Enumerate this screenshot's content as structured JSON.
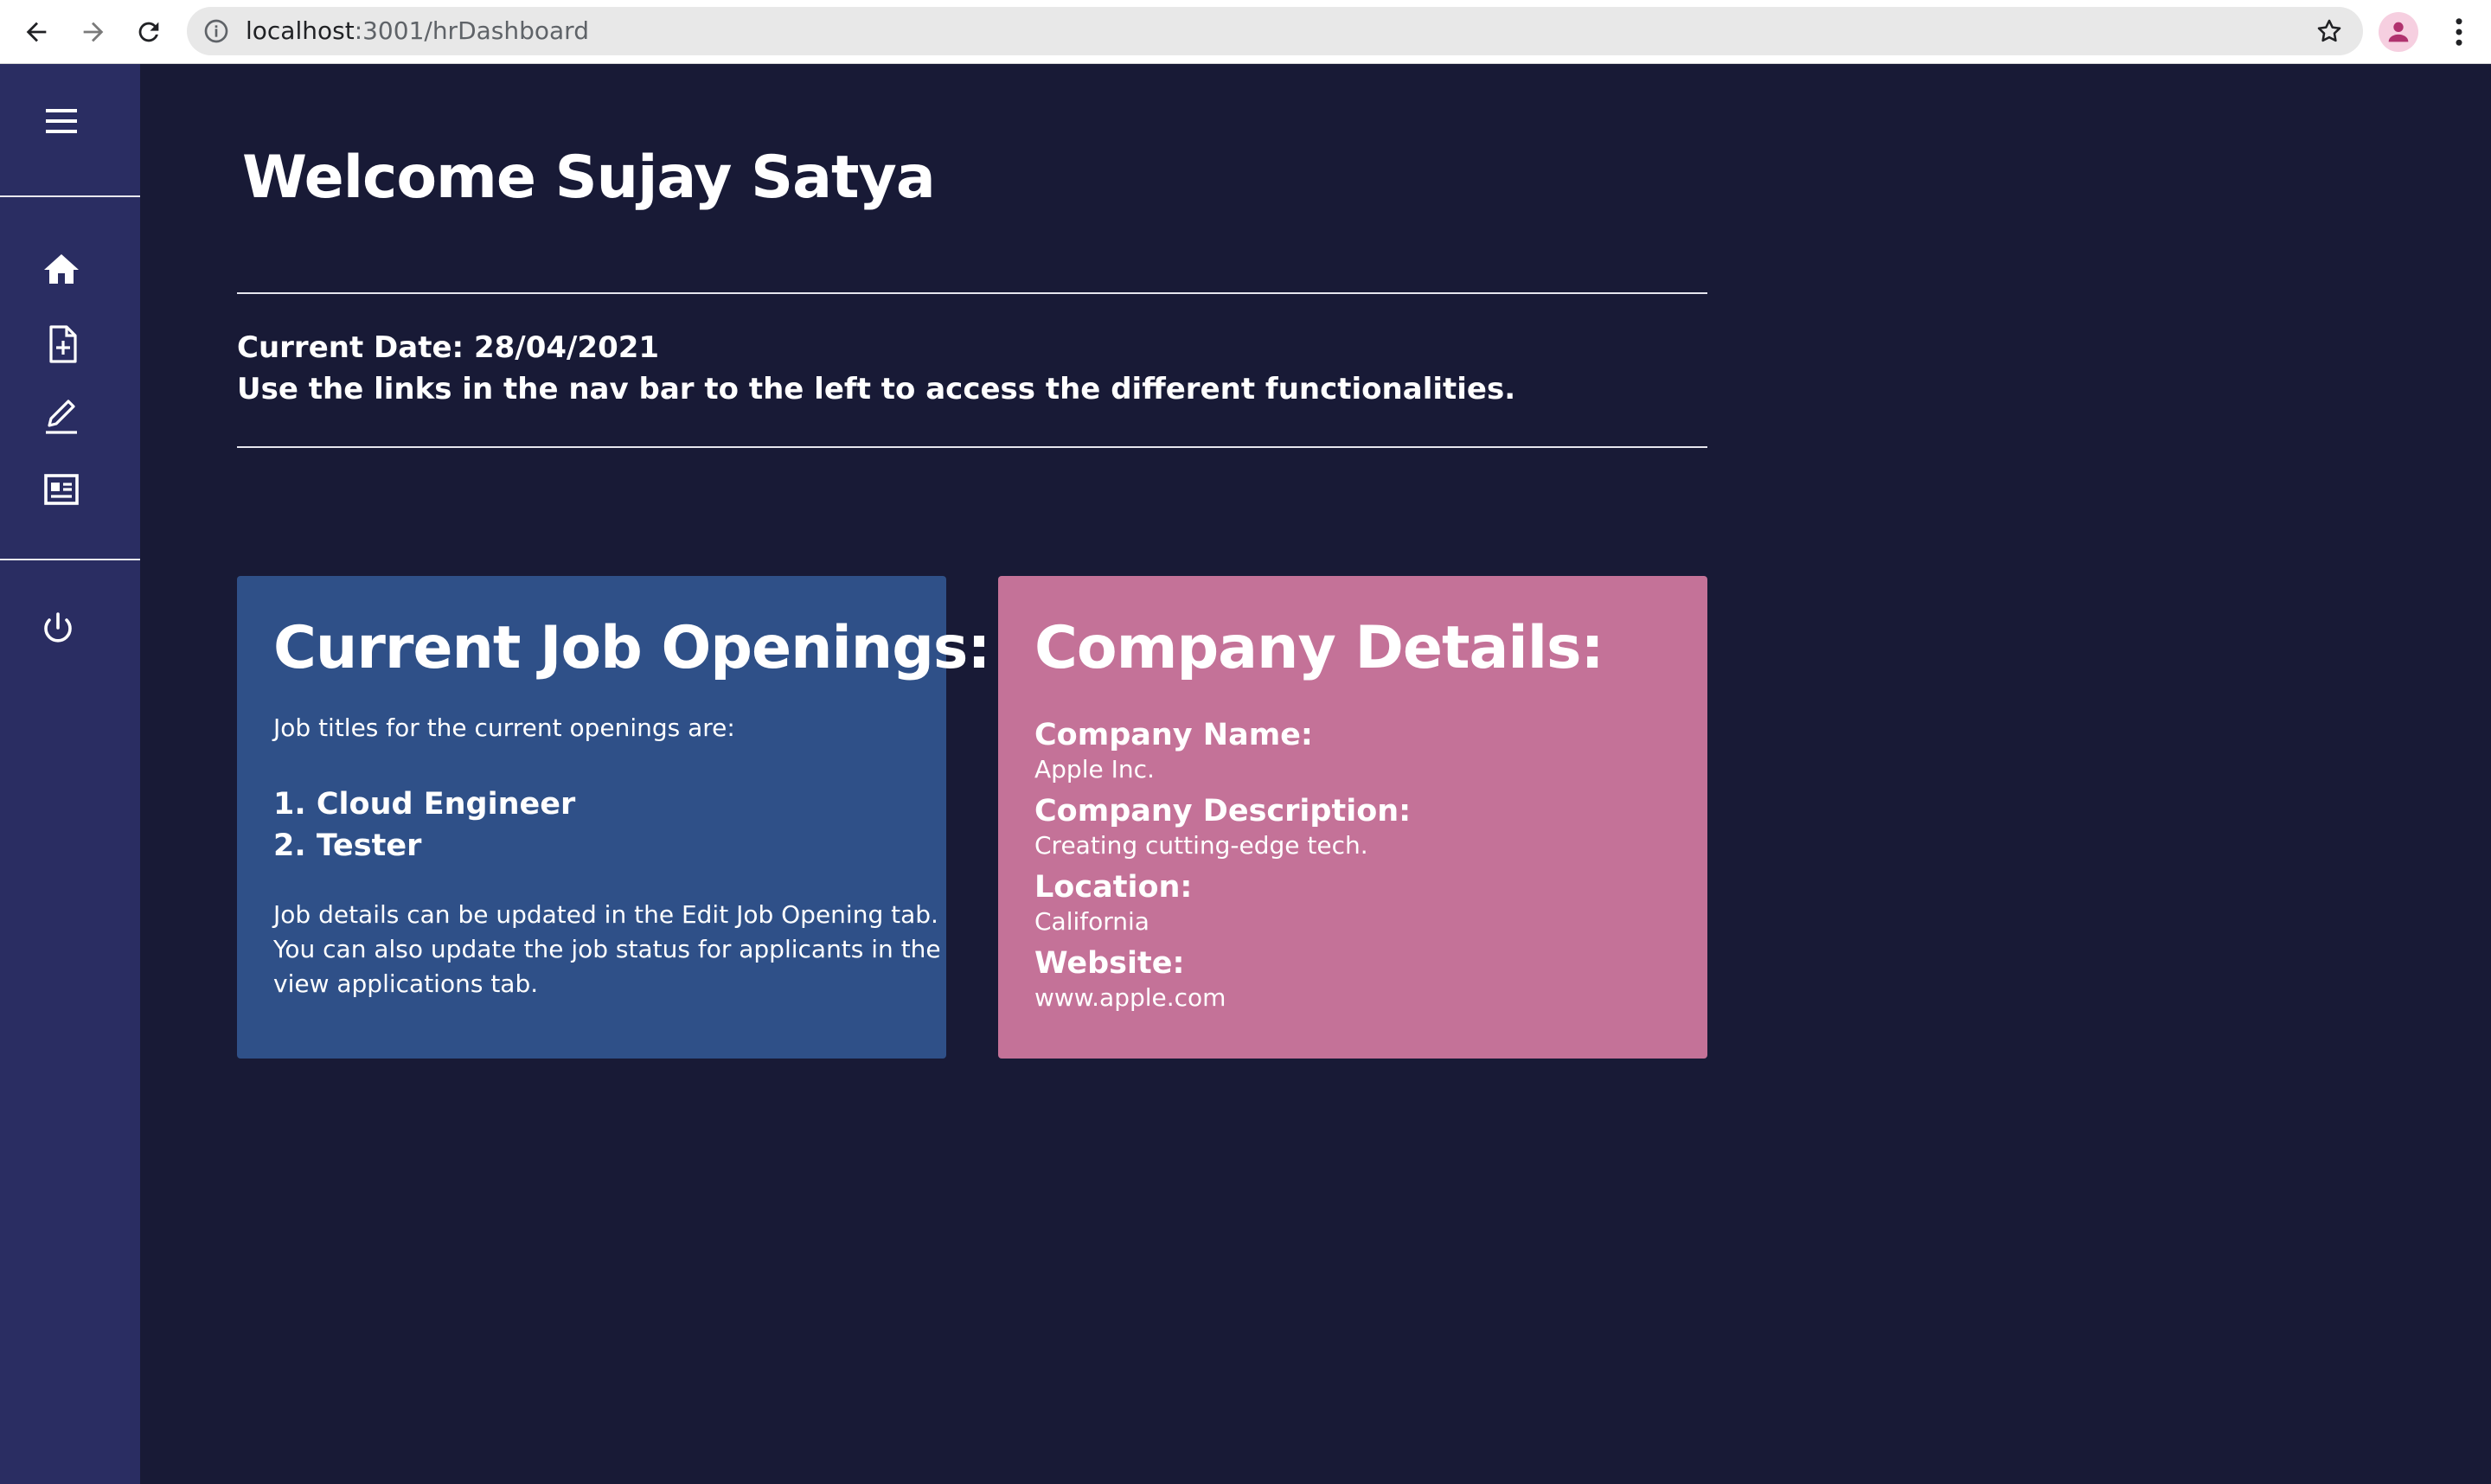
{
  "browser": {
    "url_host": "localhost",
    "url_path": ":3001/hrDashboard"
  },
  "sidebar": {
    "items": [
      {
        "icon": "menu-icon"
      },
      {
        "icon": "home-icon"
      },
      {
        "icon": "add-file-icon"
      },
      {
        "icon": "edit-icon"
      },
      {
        "icon": "applications-icon"
      },
      {
        "icon": "power-icon"
      }
    ]
  },
  "main": {
    "welcome": "Welcome Sujay Satya",
    "current_date": "Current Date: 28/04/2021",
    "nav_hint": "Use the links in the nav bar to the left to access the different functionalities."
  },
  "jobs_card": {
    "title": "Current Job Openings:",
    "intro": "Job titles for the current openings are:",
    "openings": [
      "1. Cloud Engineer",
      "2. Tester"
    ],
    "note_lines": [
      "Job details can be updated in the Edit Job Opening tab.",
      "You can also update the job status for applicants in the",
      "view applications tab."
    ]
  },
  "company_card": {
    "title": "Company Details:",
    "name_label": "Company Name:",
    "name_value": "Apple Inc.",
    "desc_label": "Company Description:",
    "desc_value": "Creating cutting-edge tech.",
    "location_label": "Location:",
    "location_value": "California",
    "website_label": "Website:",
    "website_value": "www.apple.com"
  },
  "colors": {
    "background": "#181a36",
    "sidebar": "#2a2d62",
    "jobs_card": "#2f5088",
    "company_card": "#c47298"
  }
}
